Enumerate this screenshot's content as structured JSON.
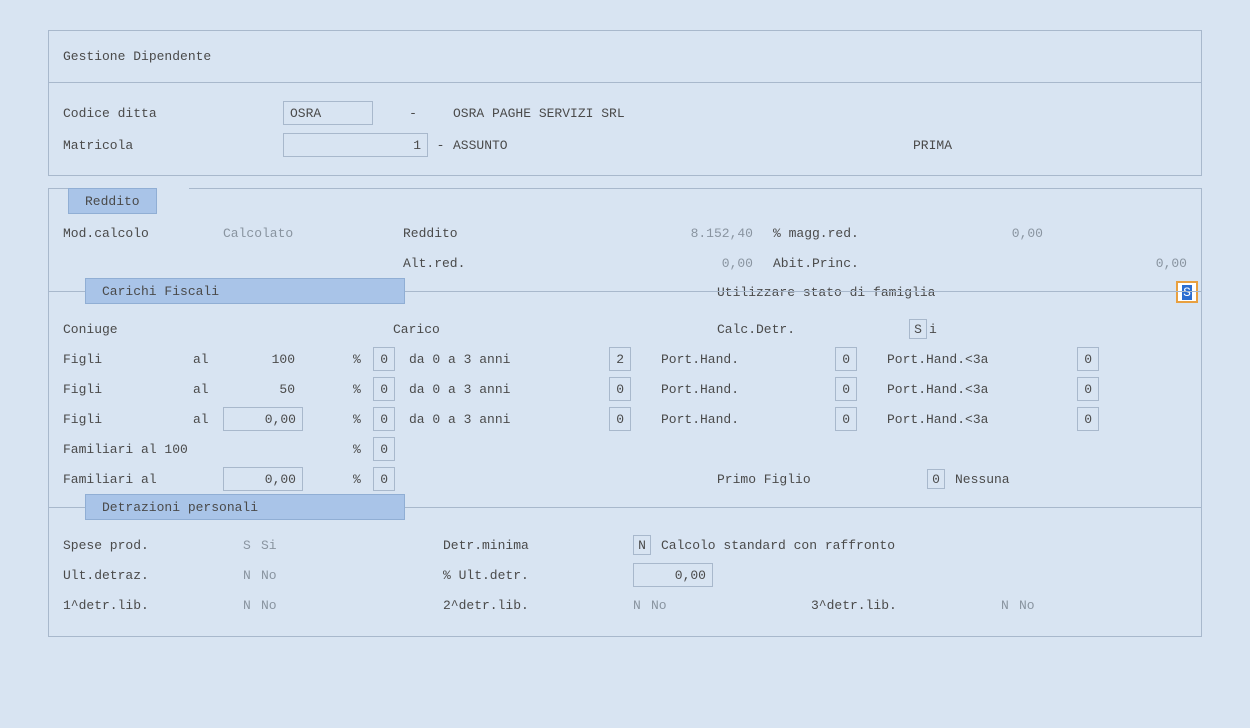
{
  "header": {
    "title": "Gestione Dipendente",
    "codice_ditta_label": "Codice ditta",
    "codice_ditta_value": "OSRA",
    "codice_ditta_desc": "OSRA PAGHE SERVIZI SRL",
    "matricola_label": "Matricola",
    "matricola_value": "1",
    "matricola_desc": "ASSUNTO",
    "matricola_extra": "PRIMA"
  },
  "tabs": {
    "reddito": "Reddito",
    "carichi": "Carichi Fiscali",
    "detrazioni": "Detrazioni personali"
  },
  "reddito": {
    "mod_calcolo_label": "Mod.calcolo",
    "mod_calcolo_value": "Calcolato",
    "reddito_label": "Reddito",
    "reddito_value": "8.152,40",
    "magg_red_label": "% magg.red.",
    "magg_red_value": "0,00",
    "alt_red_label": "Alt.red.",
    "alt_red_value": "0,00",
    "abit_princ_label": "Abit.Princ.",
    "abit_princ_value": "0,00"
  },
  "carichi": {
    "utilizzare_label": "Utilizzare stato di famiglia",
    "utilizzare_value": "S",
    "coniuge_label": "Coniuge",
    "carico_label": "Carico",
    "calc_detr_label": "Calc.Detr.",
    "calc_detr_code": "S",
    "calc_detr_desc": "i",
    "figli_label": "Figli",
    "al_label": "al",
    "pct": "%",
    "pct_100": "100",
    "pct_50": "50",
    "pct_custom": "0,00",
    "da03_label": "da 0 a 3 anni",
    "porthand_label": "Port.Hand.",
    "porthand3a_label": "Port.Hand.<3a",
    "row1": {
      "pct_val": "0",
      "da03": "2",
      "ph": "0",
      "ph3a": "0"
    },
    "row2": {
      "pct_val": "0",
      "da03": "0",
      "ph": "0",
      "ph3a": "0"
    },
    "row3": {
      "pct_val": "0",
      "da03": "0",
      "ph": "0",
      "ph3a": "0"
    },
    "familiari100_label": "Familiari al 100",
    "familiari100_val": "0",
    "familiari_al_label": "Familiari al",
    "familiari_al_pct": "0,00",
    "familiari_al_val": "0",
    "primo_figlio_label": "Primo Figlio",
    "primo_figlio_code": "0",
    "primo_figlio_desc": "Nessuna"
  },
  "detr": {
    "spese_prod_label": "Spese prod.",
    "spese_prod_code": "S",
    "spese_prod_desc": "Si",
    "detr_minima_label": "Detr.minima",
    "detr_minima_code": "N",
    "detr_minima_desc": "Calcolo standard con raffronto",
    "ult_detraz_label": "Ult.detraz.",
    "ult_detraz_code": "N",
    "ult_detraz_desc": "No",
    "pct_ult_detr_label": "% Ult.detr.",
    "pct_ult_detr_value": "0,00",
    "d1_label": "1^detr.lib.",
    "d1_code": "N",
    "d1_desc": "No",
    "d2_label": "2^detr.lib.",
    "d2_code": "N",
    "d2_desc": "No",
    "d3_label": "3^detr.lib.",
    "d3_code": "N",
    "d3_desc": "No"
  }
}
